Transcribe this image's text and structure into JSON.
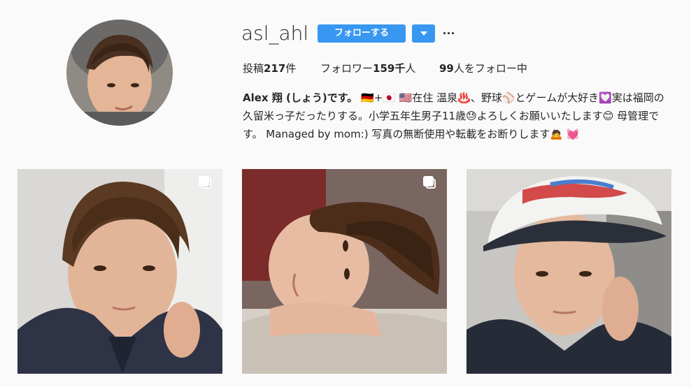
{
  "profile": {
    "username": "asl_ahl",
    "follow_label": "フォローする",
    "dropdown_icon": "caret-down-icon",
    "more_icon": "ellipsis-icon"
  },
  "stats": {
    "posts_prefix": "投稿",
    "posts_count": "217",
    "posts_suffix": "件",
    "followers_prefix": "フォロワー",
    "followers_count": "159千",
    "followers_suffix": "人",
    "following_count": "99",
    "following_suffix": "人をフォロー中"
  },
  "bio": {
    "name": "Alex 翔 (しょう)です。",
    "line1_rest": " 🇩🇪+🇯🇵 🇺🇸在住 温泉♨️、野球⚾とゲームが大好き💟実は福岡の",
    "line2": "久留米っ子だったりする。小学五年生男子11歳😓よろしくお願いいたします😊 母管理で",
    "line3": "す。 Managed by mom:) 写真の無断使用や転載をお断りします🙇 💓"
  },
  "grid": {
    "photos": [
      {
        "alt": "boy with brown hair in navy hoodie, hand at neck",
        "multi": true
      },
      {
        "alt": "boy lying on fluffy blanket resting head on arm",
        "multi": true
      },
      {
        "alt": "boy wearing baseball cap in car",
        "multi": false
      }
    ],
    "multi_icon": "carousel-icon"
  },
  "colors": {
    "accent": "#3897f0",
    "background": "#fafafa",
    "text": "#262626"
  }
}
